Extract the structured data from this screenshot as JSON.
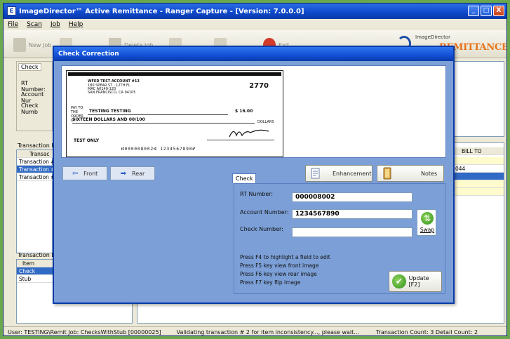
{
  "window": {
    "title": "ImageDirector™ Active Remittance - Ranger Capture - [Version: 7.0.0.0]",
    "icon": "app-icon",
    "minimize": "_",
    "maximize": "□",
    "close": "X"
  },
  "menu": [
    "File",
    "Scan",
    "Job",
    "Help"
  ],
  "toolbar": {
    "buttons": [
      "New Job",
      "",
      "Delete Job",
      "",
      "",
      "Exit"
    ]
  },
  "brand": {
    "small": "ImageDirector",
    "big": "REMITTANCE"
  },
  "left_check_panel": {
    "tab": "Check",
    "fields": [
      "RT Number:",
      "Account Nur",
      "Check Numb"
    ]
  },
  "transaction_info": {
    "label": "Transaction In",
    "header": "Transac",
    "rows": [
      "Transaction #",
      "Transaction #",
      "Transaction #"
    ]
  },
  "transaction_detail": {
    "label": "Transaction De",
    "header": "Item",
    "rows": [
      "Check",
      "Stub"
    ]
  },
  "right_grid": {
    "header": "BILL TO",
    "value": "044"
  },
  "dialog": {
    "title": "Check Correction",
    "check_image": {
      "payer_name": "WFED TEST ACCOUNT #13",
      "payer_addr1": "180 SPEAR ST - 12TH FL",
      "payer_addr2": "MAC A0149-120",
      "payer_addr3": "SAN FRANCISCO, CA 94105",
      "payee_label": "PAY TO THE ORDER OF",
      "payee": "TESTING TESTING",
      "check_number": "2770",
      "amount": "$ 16.00",
      "amount_words": "SIXTEEN DOLLARS AND 00/100",
      "dollars": "DOLLARS",
      "memo": "TEST ONLY",
      "micr": "⑆000008002⑆ 1234567890⑈"
    },
    "front_button": "Front",
    "rear_button": "Rear",
    "enhancement_button": "Enhancement",
    "notes_button": "Notes",
    "check_tab": "Check",
    "rt_label": "RT Number:",
    "rt_value": "000008002",
    "account_label": "Account Number:",
    "account_value": "1234567890",
    "check_label": "Check Number:",
    "check_value": "",
    "swap_button": "Swap",
    "hints": [
      "Press F4 to highlight a field to edit",
      "Press F5 key view front image",
      "Press F6 key view rear image",
      "Press F7 key flip image"
    ],
    "update_button": "Update [F2]"
  },
  "status": {
    "user": "User: TESTING\\Remit Job: ChecksWithStub [00000025]",
    "message": "Validating transaction # 2 for item inconsistency..., please wait...",
    "counts": "Transaction Count: 3 Detail Count: 2"
  },
  "colors": {
    "titlebar": "#0d47c9",
    "dialog_bg": "#7b9fd6",
    "selection": "#316ac5",
    "brand_orange": "#e8731a",
    "outer_green": "#6aa84f"
  }
}
